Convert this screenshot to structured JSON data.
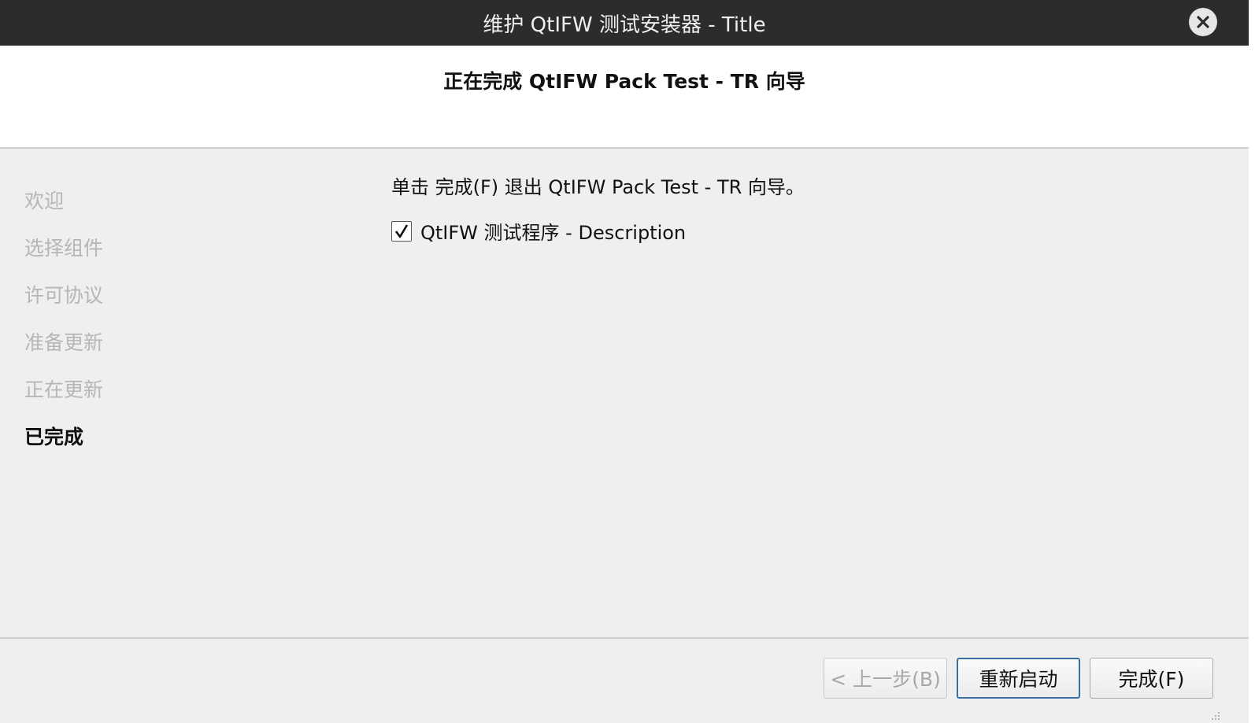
{
  "window": {
    "title": "维护 QtIFW 测试安装器 - Title"
  },
  "header": {
    "title": "正在完成 QtIFW Pack Test - TR 向导"
  },
  "sidebar": {
    "steps": [
      {
        "label": "欢迎",
        "state": "done"
      },
      {
        "label": "选择组件",
        "state": "done"
      },
      {
        "label": "许可协议",
        "state": "done"
      },
      {
        "label": "准备更新",
        "state": "done"
      },
      {
        "label": "正在更新",
        "state": "done"
      },
      {
        "label": "已完成",
        "state": "current"
      }
    ]
  },
  "content": {
    "message": "单击 完成(F) 退出 QtIFW Pack Test - TR 向导。",
    "run_program": {
      "label": "QtIFW 测试程序 - Description",
      "checked": true
    }
  },
  "buttons": {
    "back_label": "< 上一步(B)",
    "restart_label": "重新启动",
    "finish_label": "完成(F)"
  },
  "icons": {
    "close": "close-icon",
    "check": "checkmark-icon"
  },
  "colors": {
    "titlebar": "#2c2c2c",
    "default_button_border": "#3a6ea5"
  }
}
